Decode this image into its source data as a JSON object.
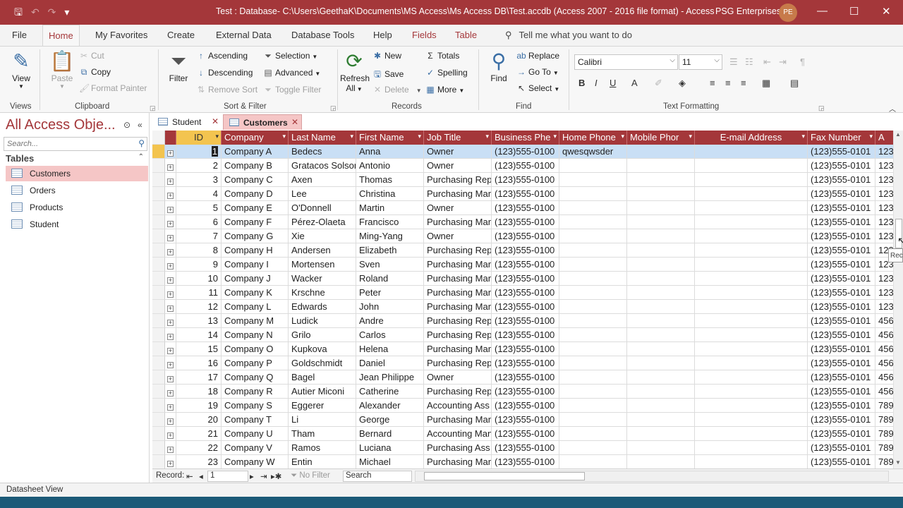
{
  "titlebar": {
    "title": "Test : Database- C:\\Users\\GeethaK\\Documents\\MS Access\\Ms Access DB\\Test.accdb (Access 2007 - 2016 file format)  -  Access",
    "user": "PSG Enterprises",
    "avatar_initials": "PE",
    "minimize": "—",
    "maximize": "☐",
    "close": "✕",
    "qat_save": "🖫",
    "qat_undo": "↶",
    "qat_redo": "↷",
    "qat_customize": "▾"
  },
  "ribbon_tabs": [
    {
      "label": "File"
    },
    {
      "label": "Home"
    },
    {
      "label": "My Favorites"
    },
    {
      "label": "Create"
    },
    {
      "label": "External Data"
    },
    {
      "label": "Database Tools"
    },
    {
      "label": "Help"
    },
    {
      "label": "Fields"
    },
    {
      "label": "Table"
    }
  ],
  "tellme": "Tell me what you want to do",
  "ribbon": {
    "views": {
      "view": "View",
      "group": "Views"
    },
    "clipboard": {
      "paste": "Paste",
      "cut": "Cut",
      "copy": "Copy",
      "format_painter": "Format Painter",
      "group": "Clipboard"
    },
    "sort_filter": {
      "filter": "Filter",
      "ascending": "Ascending",
      "descending": "Descending",
      "remove_sort": "Remove Sort",
      "selection": "Selection",
      "advanced": "Advanced",
      "toggle_filter": "Toggle Filter",
      "group": "Sort & Filter"
    },
    "records": {
      "refresh": "Refresh",
      "refresh_all": "All",
      "new": "New",
      "save": "Save",
      "delete": "Delete",
      "totals": "Totals",
      "spelling": "Spelling",
      "more": "More",
      "group": "Records"
    },
    "find": {
      "find": "Find",
      "replace": "Replace",
      "goto": "Go To",
      "select": "Select",
      "group": "Find"
    },
    "text_formatting": {
      "font": "Calibri",
      "size": "11",
      "bold": "B",
      "italic": "I",
      "underline": "U",
      "group": "Text Formatting"
    }
  },
  "nav": {
    "title": "All Access Obje...",
    "search_placeholder": "Search...",
    "group": "Tables",
    "items": [
      {
        "label": "Customers"
      },
      {
        "label": "Orders"
      },
      {
        "label": "Products"
      },
      {
        "label": "Student"
      }
    ]
  },
  "doc_tabs": [
    {
      "label": "Student"
    },
    {
      "label": "Customers"
    }
  ],
  "table": {
    "columns": [
      "ID",
      "Company",
      "Last Name",
      "First Name",
      "Job Title",
      "Business Phe",
      "Home Phone",
      "Mobile Phor",
      "E-mail Address",
      "Fax Number",
      "A"
    ],
    "rows": [
      [
        "1",
        "Company A",
        "Bedecs",
        "Anna",
        "Owner",
        "(123)555-0100",
        "qwesqwsder",
        "",
        "",
        "(123)555-0101",
        "123"
      ],
      [
        "2",
        "Company B",
        "Gratacos Solsona",
        "Antonio",
        "Owner",
        "(123)555-0100",
        "",
        "",
        "",
        "(123)555-0101",
        "123"
      ],
      [
        "3",
        "Company C",
        "Axen",
        "Thomas",
        "Purchasing Rep",
        "(123)555-0100",
        "",
        "",
        "",
        "(123)555-0101",
        "123"
      ],
      [
        "4",
        "Company D",
        "Lee",
        "Christina",
        "Purchasing Man",
        "(123)555-0100",
        "",
        "",
        "",
        "(123)555-0101",
        "123"
      ],
      [
        "5",
        "Company E",
        "O'Donnell",
        "Martin",
        "Owner",
        "(123)555-0100",
        "",
        "",
        "",
        "(123)555-0101",
        "123"
      ],
      [
        "6",
        "Company F",
        "Pérez-Olaeta",
        "Francisco",
        "Purchasing Man",
        "(123)555-0100",
        "",
        "",
        "",
        "(123)555-0101",
        "123"
      ],
      [
        "7",
        "Company G",
        "Xie",
        "Ming-Yang",
        "Owner",
        "(123)555-0100",
        "",
        "",
        "",
        "(123)555-0101",
        "123"
      ],
      [
        "8",
        "Company H",
        "Andersen",
        "Elizabeth",
        "Purchasing Rep",
        "(123)555-0100",
        "",
        "",
        "",
        "(123)555-0101",
        "123"
      ],
      [
        "9",
        "Company I",
        "Mortensen",
        "Sven",
        "Purchasing Man",
        "(123)555-0100",
        "",
        "",
        "",
        "(123)555-0101",
        "123"
      ],
      [
        "10",
        "Company J",
        "Wacker",
        "Roland",
        "Purchasing Man",
        "(123)555-0100",
        "",
        "",
        "",
        "(123)555-0101",
        "123"
      ],
      [
        "11",
        "Company K",
        "Krschne",
        "Peter",
        "Purchasing Man",
        "(123)555-0100",
        "",
        "",
        "",
        "(123)555-0101",
        "123"
      ],
      [
        "12",
        "Company L",
        "Edwards",
        "John",
        "Purchasing Man",
        "(123)555-0100",
        "",
        "",
        "",
        "(123)555-0101",
        "123"
      ],
      [
        "13",
        "Company M",
        "Ludick",
        "Andre",
        "Purchasing Rep",
        "(123)555-0100",
        "",
        "",
        "",
        "(123)555-0101",
        "456"
      ],
      [
        "14",
        "Company N",
        "Grilo",
        "Carlos",
        "Purchasing Rep",
        "(123)555-0100",
        "",
        "",
        "",
        "(123)555-0101",
        "456"
      ],
      [
        "15",
        "Company O",
        "Kupkova",
        "Helena",
        "Purchasing Man",
        "(123)555-0100",
        "",
        "",
        "",
        "(123)555-0101",
        "456"
      ],
      [
        "16",
        "Company P",
        "Goldschmidt",
        "Daniel",
        "Purchasing Rep",
        "(123)555-0100",
        "",
        "",
        "",
        "(123)555-0101",
        "456"
      ],
      [
        "17",
        "Company Q",
        "Bagel",
        "Jean Philippe",
        "Owner",
        "(123)555-0100",
        "",
        "",
        "",
        "(123)555-0101",
        "456"
      ],
      [
        "18",
        "Company R",
        "Autier Miconi",
        "Catherine",
        "Purchasing Rep",
        "(123)555-0100",
        "",
        "",
        "",
        "(123)555-0101",
        "456"
      ],
      [
        "19",
        "Company S",
        "Eggerer",
        "Alexander",
        "Accounting Ass",
        "(123)555-0100",
        "",
        "",
        "",
        "(123)555-0101",
        "789"
      ],
      [
        "20",
        "Company T",
        "Li",
        "George",
        "Purchasing Man",
        "(123)555-0100",
        "",
        "",
        "",
        "(123)555-0101",
        "789"
      ],
      [
        "21",
        "Company U",
        "Tham",
        "Bernard",
        "Accounting Man",
        "(123)555-0100",
        "",
        "",
        "",
        "(123)555-0101",
        "789"
      ],
      [
        "22",
        "Company V",
        "Ramos",
        "Luciana",
        "Purchasing Ass",
        "(123)555-0100",
        "",
        "",
        "",
        "(123)555-0101",
        "789"
      ],
      [
        "23",
        "Company W",
        "Entin",
        "Michael",
        "Purchasing Man",
        "(123)555-0100",
        "",
        "",
        "",
        "(123)555-0101",
        "789"
      ]
    ]
  },
  "record_nav": {
    "label": "Record:",
    "current": "1",
    "no_filter": "No Filter",
    "search": "Search"
  },
  "tooltip": "Rec",
  "status": "Datasheet View",
  "colors": {
    "accent": "#a4373a",
    "header_selected": "#f3c44f",
    "row_selected": "#c9dff5",
    "nav_selected": "#f5c6c6"
  }
}
